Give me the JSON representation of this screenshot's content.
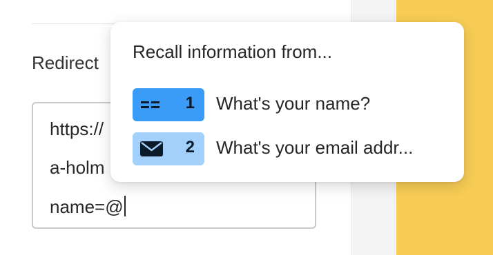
{
  "form": {
    "label": "Redirect",
    "url_lines": [
      "https://",
      "a-holm",
      "name=@"
    ]
  },
  "recall": {
    "title": "Recall information from...",
    "options": [
      {
        "number": "1",
        "icon": "short-text-icon",
        "label": "What's your name?",
        "color": "#3a9cf7"
      },
      {
        "number": "2",
        "icon": "envelope-icon",
        "label": "What's your email addr...",
        "color": "#a2d0fb"
      }
    ]
  },
  "colors": {
    "accent_yellow": "#f8cd55",
    "side_gray": "#f4f4f4"
  }
}
